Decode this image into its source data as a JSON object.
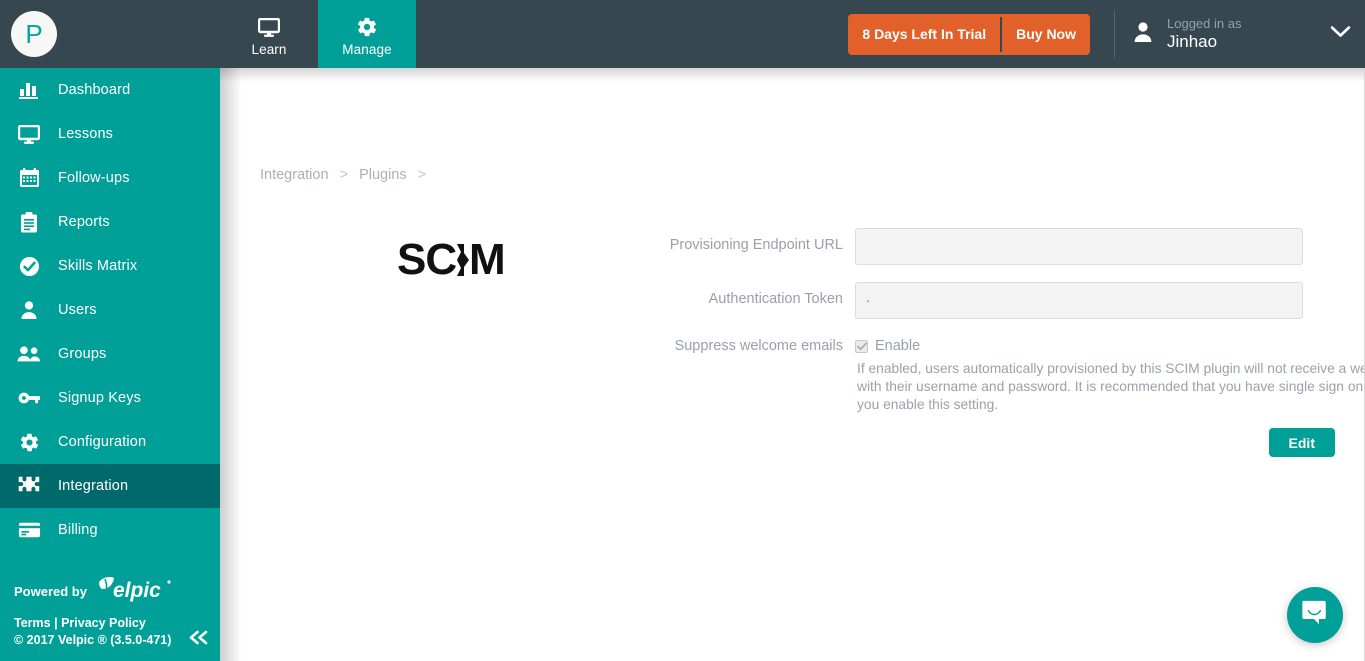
{
  "header": {
    "brand_initial": "P",
    "tabs": [
      {
        "label": "Learn",
        "icon": "monitor-icon",
        "active": false
      },
      {
        "label": "Manage",
        "icon": "gear-icon",
        "active": true
      }
    ],
    "trial": {
      "days_label": "8 Days Left In Trial",
      "buy_label": "Buy Now",
      "color": "#e2602a"
    },
    "user": {
      "logged_in_label": "Logged in as",
      "name": "Jinhao",
      "avatar_icon": "person-icon",
      "caret_icon": "chevron-down-icon"
    }
  },
  "sidebar": {
    "bg_color": "#00a099",
    "active_color": "#00696b",
    "items": [
      {
        "label": "Dashboard",
        "icon": "bar-chart-icon",
        "active": false
      },
      {
        "label": "Lessons",
        "icon": "monitor-icon",
        "active": false
      },
      {
        "label": "Follow-ups",
        "icon": "calendar-icon",
        "active": false
      },
      {
        "label": "Reports",
        "icon": "clipboard-icon",
        "active": false
      },
      {
        "label": "Skills Matrix",
        "icon": "check-circle-icon",
        "active": false
      },
      {
        "label": "Users",
        "icon": "person-icon",
        "active": false
      },
      {
        "label": "Groups",
        "icon": "people-icon",
        "active": false
      },
      {
        "label": "Signup Keys",
        "icon": "key-icon",
        "active": false
      },
      {
        "label": "Configuration",
        "icon": "gear-icon",
        "active": false
      },
      {
        "label": "Integration",
        "icon": "puzzle-piece-icon",
        "active": true
      },
      {
        "label": "Billing",
        "icon": "credit-card-icon",
        "active": false
      }
    ],
    "footer": {
      "powered_by": "Powered by",
      "brand_wordmark": "velpic",
      "terms": "Terms",
      "divider": "|",
      "privacy": "Privacy Policy",
      "copyright": "© 2017 Velpic ® (3.5.0-471)",
      "collapse_icon": "double-chevron-left-icon"
    }
  },
  "main": {
    "breadcrumb": [
      {
        "label": "Integration"
      },
      {
        "label": "Plugins"
      }
    ],
    "breadcrumb_separator": ">",
    "plugin_logo": "scim-logo",
    "form": {
      "fields": [
        {
          "label": "Provisioning Endpoint URL",
          "value": "",
          "placeholder": ""
        },
        {
          "label": "Authentication Token",
          "value": "·",
          "placeholder": ""
        }
      ],
      "checkbox": {
        "label": "Suppress welcome emails",
        "option_label": "Enable",
        "checked": true,
        "disabled": true
      },
      "help_text": "If enabled, users automatically provisioned by this SCIM plugin will not receive a welcome email with their username and password. It is recommended that you have single sign on configured if you enable this setting."
    },
    "edit_button": "Edit",
    "accent_color": "#00a099"
  },
  "intercom": {
    "icon": "chat-smile-icon",
    "color": "#00a099"
  }
}
